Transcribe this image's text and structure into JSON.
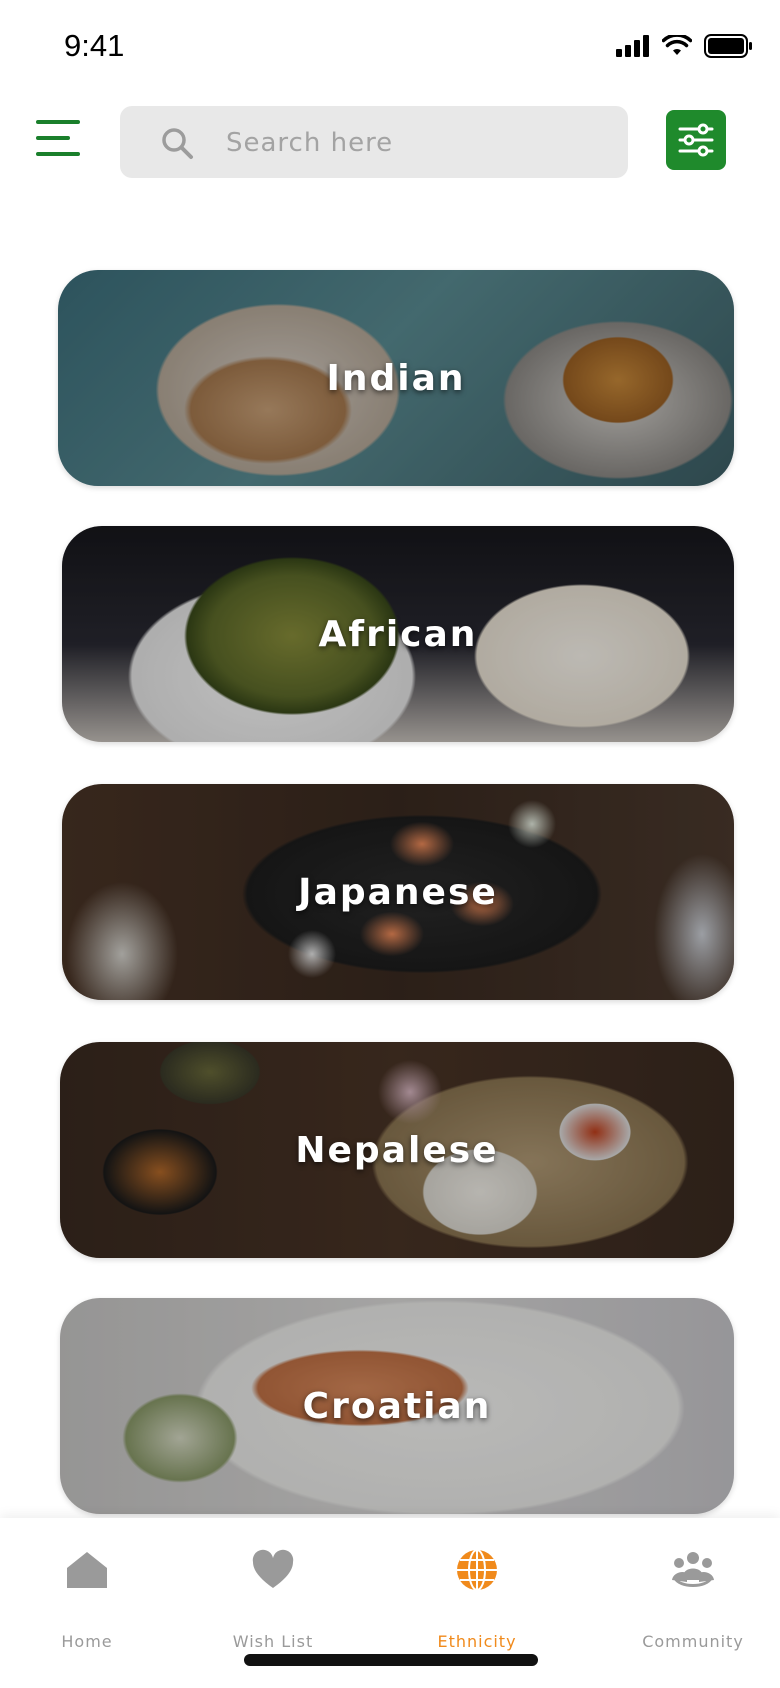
{
  "status_bar": {
    "time": "9:41"
  },
  "search": {
    "placeholder": "Search here",
    "value": ""
  },
  "cards": [
    {
      "label": "Indian"
    },
    {
      "label": "African"
    },
    {
      "label": "Japanese"
    },
    {
      "label": "Nepalese"
    },
    {
      "label": "Croatian"
    }
  ],
  "nav": {
    "items": [
      {
        "label": "Home",
        "icon": "home-icon"
      },
      {
        "label": "Wish List",
        "icon": "heart-icon"
      },
      {
        "label": "Ethnicity",
        "icon": "globe-icon",
        "active": true
      },
      {
        "label": "Community",
        "icon": "community-icon"
      }
    ]
  },
  "colors": {
    "accent_green": "#1f8a2c",
    "active_orange": "#f08a1c",
    "inactive_gray": "#9a9a9a"
  }
}
